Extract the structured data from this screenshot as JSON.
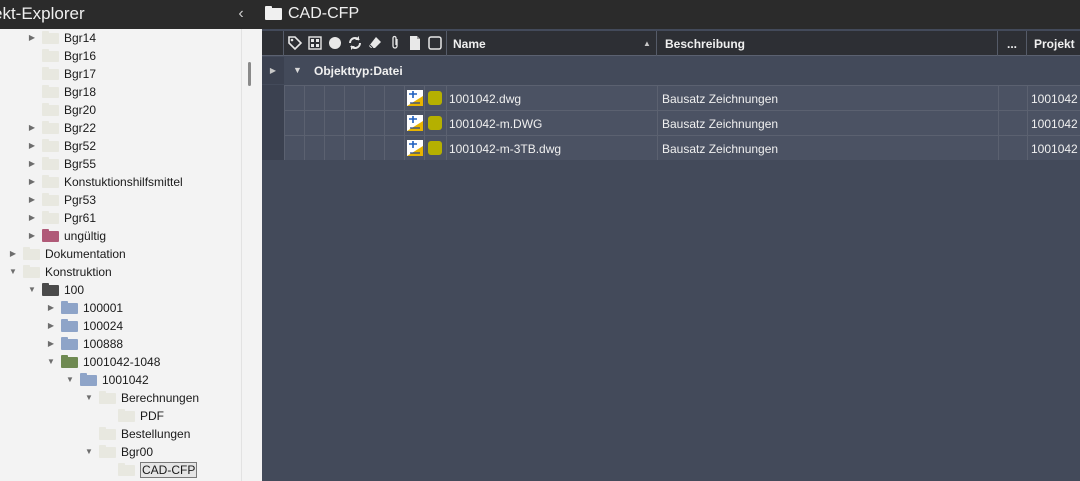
{
  "explorer": {
    "title": "ekt-Explorer",
    "collapse_icon": "chevron-left-icon",
    "tree": [
      {
        "label": "Bgr14",
        "arrow": "right",
        "folder": "#e8e8e0"
      },
      {
        "label": "Bgr16",
        "arrow": "",
        "folder": "#e8e8e0"
      },
      {
        "label": "Bgr17",
        "arrow": "",
        "folder": "#e8e8e0"
      },
      {
        "label": "Bgr18",
        "arrow": "",
        "folder": "#e8e8e0"
      },
      {
        "label": "Bgr20",
        "arrow": "",
        "folder": "#e8e8e0"
      },
      {
        "label": "Bgr22",
        "arrow": "right",
        "folder": "#e8e8e0"
      },
      {
        "label": "Bgr52",
        "arrow": "right",
        "folder": "#e8e8e0"
      },
      {
        "label": "Bgr55",
        "arrow": "right",
        "folder": "#e8e8e0"
      },
      {
        "label": "Konstuktionshilfsmittel",
        "arrow": "right",
        "folder": "#e8e8e0"
      },
      {
        "label": "Pgr53",
        "arrow": "right",
        "folder": "#e8e8e0"
      },
      {
        "label": "Pgr61",
        "arrow": "right",
        "folder": "#e8e8e0"
      },
      {
        "label": "ungültig",
        "arrow": "right",
        "folder": "#b05a78"
      },
      {
        "label": "Dokumentation",
        "arrow": "right",
        "folder": "#e8e8e0"
      },
      {
        "label": "Konstruktion",
        "arrow": "down",
        "folder": "#e8e8e0"
      },
      {
        "label": "100",
        "arrow": "down",
        "folder": "#4a4a4a"
      },
      {
        "label": "100001",
        "arrow": "right",
        "folder": "#8ea4c8"
      },
      {
        "label": "100024",
        "arrow": "right",
        "folder": "#8ea4c8"
      },
      {
        "label": "100888",
        "arrow": "right",
        "folder": "#8ea4c8"
      },
      {
        "label": "1001042-1048",
        "arrow": "down",
        "folder": "#6f8a52"
      },
      {
        "label": "1001042",
        "arrow": "down",
        "folder": "#8ea4c8"
      },
      {
        "label": "Berechnungen",
        "arrow": "down",
        "folder": "#e8e8e0"
      },
      {
        "label": "PDF",
        "arrow": "",
        "folder": "#e8e8e0"
      },
      {
        "label": "Bestellungen",
        "arrow": "",
        "folder": "#e8e8e0"
      },
      {
        "label": "Bgr00",
        "arrow": "down",
        "folder": "#e8e8e0"
      },
      {
        "label": "CAD-CFP",
        "arrow": "",
        "folder": "#e8e8e0",
        "selected": true
      }
    ]
  },
  "content": {
    "breadcrumb_title": "CAD-CFP",
    "header_icons": [
      "tag-icon",
      "grid-icon",
      "circle-icon",
      "recycle-icon",
      "eraser-icon",
      "paperclip-icon",
      "document-icon",
      "square-icon"
    ],
    "columns": {
      "name": "Name",
      "description": "Beschreibung",
      "more": "...",
      "project": "Projekt"
    },
    "group_label": "Objekttyp:Datei",
    "rows": [
      {
        "name": "1001042.dwg",
        "description": "Bausatz Zeichnungen",
        "project": "1001042"
      },
      {
        "name": "1001042-m.DWG",
        "description": "Bausatz Zeichnungen",
        "project": "1001042"
      },
      {
        "name": "1001042-m-3TB.dwg",
        "description": "Bausatz Zeichnungen",
        "project": "1001042"
      }
    ],
    "status_color": "#b5b000"
  }
}
